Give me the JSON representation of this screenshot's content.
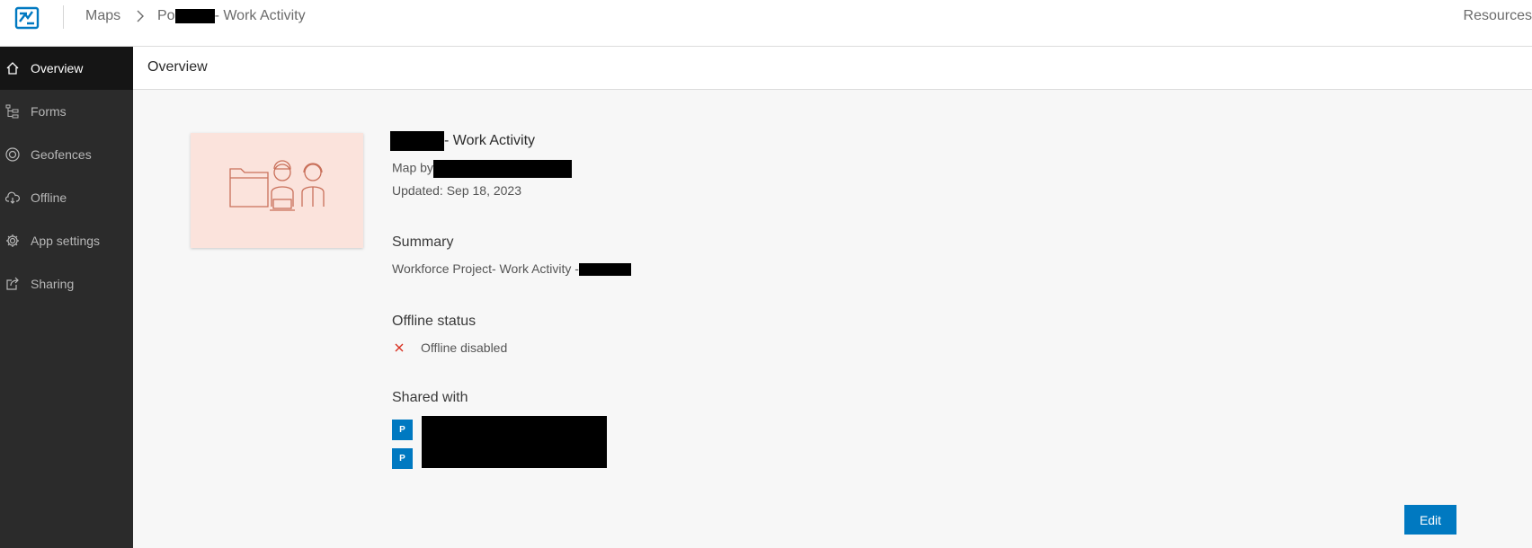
{
  "header": {
    "breadcrumb_root": "Maps",
    "breadcrumb_item_prefix": "Po",
    "breadcrumb_item_suffix": "- Work Activity",
    "resources": "Resources"
  },
  "sidebar": {
    "items": [
      {
        "label": "Overview",
        "icon": "home-icon",
        "active": true
      },
      {
        "label": "Forms",
        "icon": "forms-tree-icon",
        "active": false
      },
      {
        "label": "Geofences",
        "icon": "geofence-icon",
        "active": false
      },
      {
        "label": "Offline",
        "icon": "cloud-download-icon",
        "active": false
      },
      {
        "label": "App settings",
        "icon": "gear-icon",
        "active": false
      },
      {
        "label": "Sharing",
        "icon": "share-icon",
        "active": false
      }
    ]
  },
  "main": {
    "page_title": "Overview",
    "item_title_suffix": "- Work Activity",
    "map_by_label": "Map by",
    "updated": "Updated: Sep 18, 2023",
    "summary_heading": "Summary",
    "summary_text": "Workforce Project- Work Activity -",
    "offline_heading": "Offline status",
    "offline_text": "Offline disabled",
    "shared_heading": "Shared with",
    "shared_badges": [
      "P",
      "P"
    ],
    "edit_label": "Edit"
  },
  "colors": {
    "accent": "#0079c1",
    "sidebar_bg": "#2b2b2b",
    "sidebar_active": "#151515",
    "thumbnail_bg": "#fbe3dc",
    "offline_x": "#d83020"
  }
}
